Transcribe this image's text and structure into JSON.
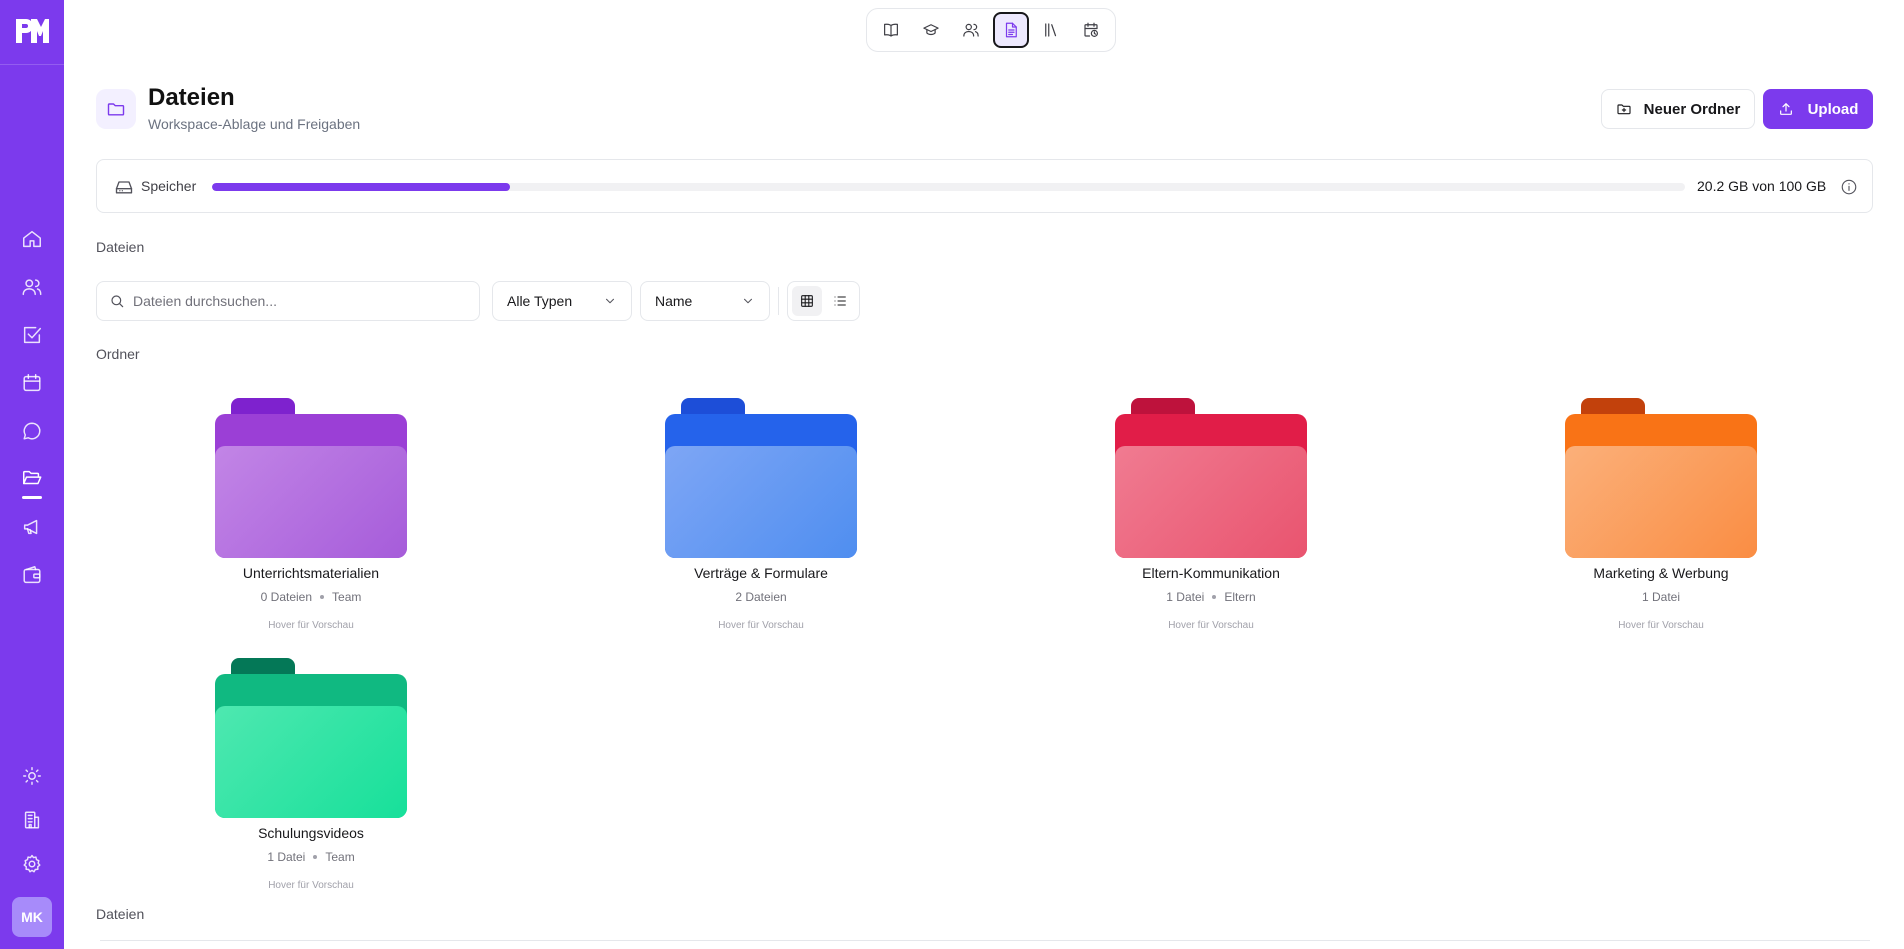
{
  "app": {
    "logo_text": "PM",
    "user_initials": "MK"
  },
  "sidebar": {
    "items": [
      {
        "name": "home-icon"
      },
      {
        "name": "users-icon"
      },
      {
        "name": "tasks-icon"
      },
      {
        "name": "calendar-icon"
      },
      {
        "name": "chat-icon"
      },
      {
        "name": "folder-open-icon",
        "active": true
      },
      {
        "name": "megaphone-icon"
      },
      {
        "name": "wallet-icon"
      }
    ],
    "bottom_items": [
      {
        "name": "sun-icon"
      },
      {
        "name": "building-icon"
      },
      {
        "name": "settings-icon"
      }
    ]
  },
  "topnav": {
    "items": [
      {
        "name": "book-icon"
      },
      {
        "name": "graduation-cap-icon"
      },
      {
        "name": "users-icon"
      },
      {
        "name": "document-icon",
        "active": true
      },
      {
        "name": "library-icon"
      },
      {
        "name": "calendar-clock-icon"
      }
    ]
  },
  "header": {
    "title": "Dateien",
    "subtitle": "Workspace-Ablage und Freigaben",
    "new_folder_label": "Neuer Ordner",
    "upload_label": "Upload"
  },
  "storage": {
    "label": "Speicher",
    "used_text": "20.2 GB von 100 GB",
    "used_fraction": 0.202
  },
  "files_section_label": "Dateien",
  "filters": {
    "search_placeholder": "Dateien durchsuchen...",
    "type_value": "Alle Typen",
    "sort_value": "Name",
    "view_modes": [
      "grid",
      "list"
    ],
    "active_view": "grid"
  },
  "folders_section_label": "Ordner",
  "folders": [
    {
      "name": "Unterrichtsmaterialien",
      "count": "0 Dateien",
      "tag": "Team",
      "hint": "Hover für Vorschau",
      "color_tab": "#7e22ce",
      "color_back": "#9b3fd6",
      "color_front_a": "#c285e6",
      "color_front_b": "#a65cda"
    },
    {
      "name": "Verträge & Formulare",
      "count": "2 Dateien",
      "tag": "",
      "hint": "Hover für Vorschau",
      "color_tab": "#1d4ed8",
      "color_back": "#2563eb",
      "color_front_a": "#7ea6f5",
      "color_front_b": "#4f8ef0"
    },
    {
      "name": "Eltern-Kommunikation",
      "count": "1 Datei",
      "tag": "Eltern",
      "hint": "Hover für Vorschau",
      "color_tab": "#be123c",
      "color_back": "#e11d48",
      "color_front_a": "#f07b91",
      "color_front_b": "#e9546f"
    },
    {
      "name": "Marketing & Werbung",
      "count": "1 Datei",
      "tag": "",
      "hint": "Hover für Vorschau",
      "color_tab": "#c2410c",
      "color_back": "#f97316",
      "color_front_a": "#fbb07a",
      "color_front_b": "#fa8d43"
    },
    {
      "name": "Schulungsvideos",
      "count": "1 Datei",
      "tag": "Team",
      "hint": "Hover für Vorschau",
      "color_tab": "#047857",
      "color_back": "#10b981",
      "color_front_a": "#4ee8b0",
      "color_front_b": "#17e09a"
    }
  ],
  "files_section_label_bottom": "Dateien"
}
